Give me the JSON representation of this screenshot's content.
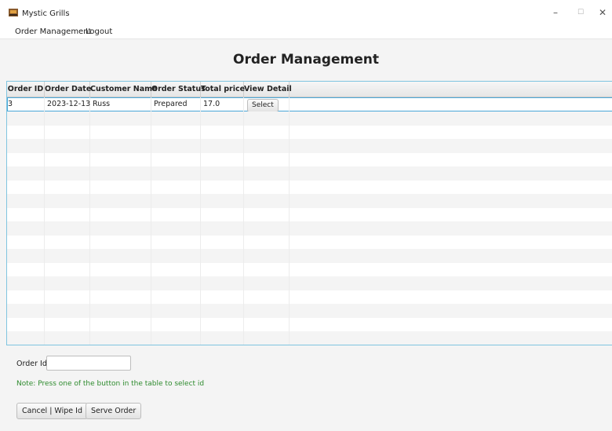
{
  "window": {
    "title": "Mystic Grills",
    "minimize": "–",
    "maximize": "☐",
    "close": "✕"
  },
  "menu": {
    "items": [
      "Order Management",
      "Logout"
    ]
  },
  "page": {
    "title": "Order Management"
  },
  "table": {
    "columns": [
      "Order ID",
      "Order Date",
      "Customer Name",
      "Order Status",
      "Total price",
      "View Detail"
    ],
    "rows": [
      {
        "order_id": "3",
        "order_date": "2023-12-13",
        "customer_name": "Russ",
        "order_status": "Prepared",
        "total_price": "17.0",
        "action": "Select"
      }
    ]
  },
  "form": {
    "order_id_label": "Order Id:",
    "order_id_value": "",
    "note": "Note: Press one of the button in the table to select id",
    "cancel_label": "Cancel | Wipe Id",
    "serve_label": "Serve Order"
  },
  "colors": {
    "accent": "#4aa8d8",
    "note": "#2e8b2e"
  }
}
